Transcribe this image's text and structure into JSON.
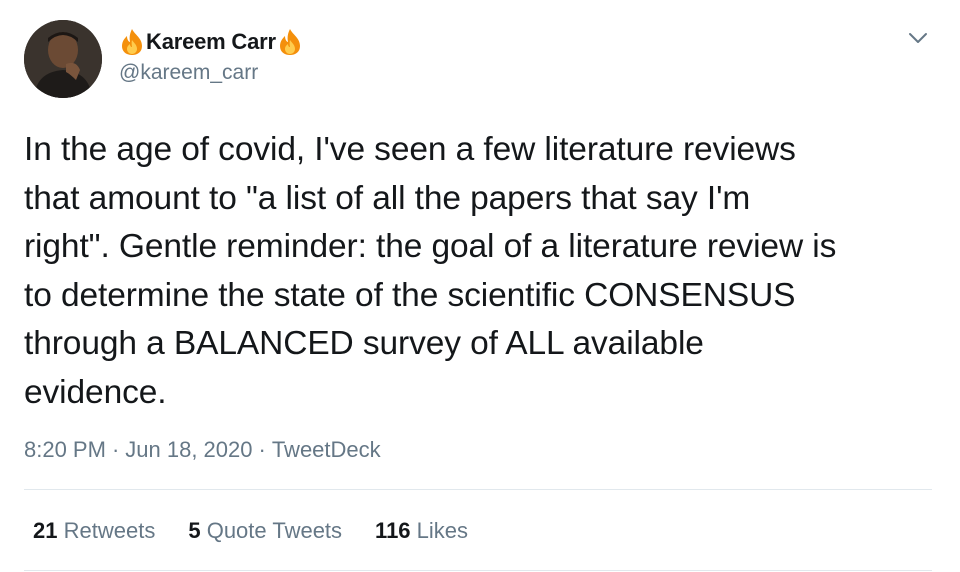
{
  "tweet": {
    "author": {
      "display_name": "Kareem Carr",
      "handle": "@kareem_carr",
      "name_emoji": "fire-icon"
    },
    "text_lines": [
      "In the age of covid, I've seen a few literature reviews",
      "that amount to \"a list of all the papers that say I'm",
      "right\". Gentle reminder: the goal of a literature review is",
      "to determine the state of the scientific CONSENSUS",
      "through a BALANCED survey of ALL available",
      "evidence."
    ],
    "time": "8:20 PM",
    "separator": "·",
    "date": "Jun 18, 2020",
    "source": "TweetDeck",
    "stats": {
      "retweets_count": "21",
      "retweets_label": "Retweets",
      "quote_count": "5",
      "quote_label": "Quote Tweets",
      "likes_count": "116",
      "likes_label": "Likes"
    }
  },
  "colors": {
    "text_primary": "#14171a",
    "text_secondary": "#657786",
    "divider": "#e1e8ed",
    "fire_outer": "#f4900c",
    "fire_inner": "#ffcc4d"
  }
}
